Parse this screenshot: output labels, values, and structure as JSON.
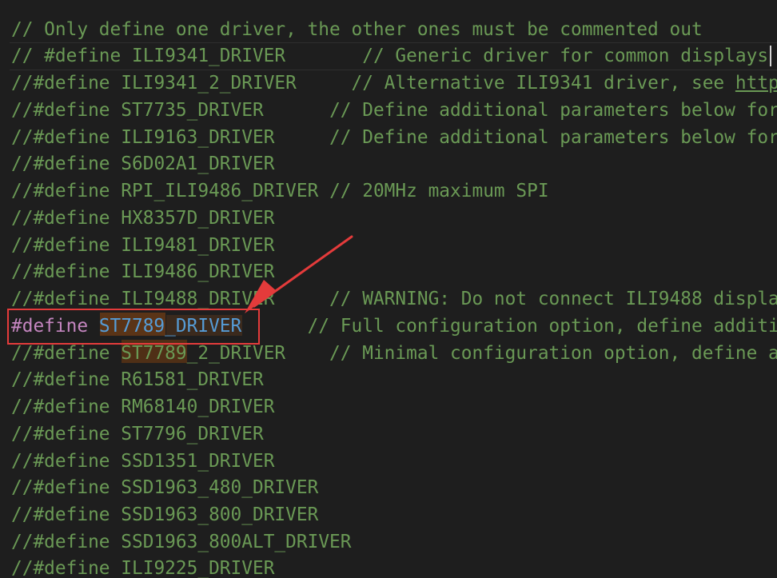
{
  "editor": {
    "lines": [
      {
        "comment": "// Only define one driver, the other ones must be commented out"
      },
      {
        "prefix": "// #define",
        "macro": "ILI9341_DRIVER",
        "pad": "       ",
        "comment": "// Generic driver for common displays"
      },
      {
        "prefix": "//#define",
        "macro": "ILI9341_2_DRIVER",
        "pad": "     ",
        "comment": "// Alternative ILI9341 driver, see ",
        "link": "http"
      },
      {
        "prefix": "//#define",
        "macro": "ST7735_DRIVER",
        "pad": "      ",
        "comment": "// Define additional parameters below for"
      },
      {
        "prefix": "//#define",
        "macro": "ILI9163_DRIVER",
        "pad": "     ",
        "comment": "// Define additional parameters below for"
      },
      {
        "prefix": "//#define",
        "macro": "S6D02A1_DRIVER"
      },
      {
        "prefix": "//#define",
        "macro": "RPI_ILI9486_DRIVER",
        "pad": " ",
        "comment": "// 20MHz maximum SPI"
      },
      {
        "prefix": "//#define",
        "macro": "HX8357D_DRIVER"
      },
      {
        "prefix": "//#define",
        "macro": "ILI9481_DRIVER"
      },
      {
        "prefix": "//#define",
        "macro": "ILI9486_DRIVER"
      },
      {
        "prefix": "//#define",
        "macro": "ILI9488_DRIVER",
        "pad": "     ",
        "comment": "// WARNING: Do not connect ILI9488 displa"
      },
      {
        "active": true,
        "keyword": "#define",
        "macro_a": "ST7789",
        "macro_b": "_DRIVER",
        "pad": "      ",
        "comment": "// Full configuration option, define additi"
      },
      {
        "prefix": "//#define",
        "macro": "ST7789_2_DRIVER",
        "pad": "    ",
        "comment": "// Minimal configuration option, define a"
      },
      {
        "prefix": "//#define",
        "macro": "R61581_DRIVER"
      },
      {
        "prefix": "//#define",
        "macro": "RM68140_DRIVER"
      },
      {
        "prefix": "//#define",
        "macro": "ST7796_DRIVER"
      },
      {
        "prefix": "//#define",
        "macro": "SSD1351_DRIVER"
      },
      {
        "prefix": "//#define",
        "macro": "SSD1963_480_DRIVER"
      },
      {
        "prefix": "//#define",
        "macro": "SSD1963_800_DRIVER"
      },
      {
        "prefix": "//#define",
        "macro": "SSD1963_800ALT_DRIVER"
      },
      {
        "prefix": "//#define",
        "macro": "ILI9225_DRIVER"
      }
    ]
  },
  "colors": {
    "background": "#1e1e1e",
    "comment": "#6a9955",
    "keyword": "#c586c0",
    "macro": "#569cd6",
    "annotation": "#e43b3b"
  }
}
